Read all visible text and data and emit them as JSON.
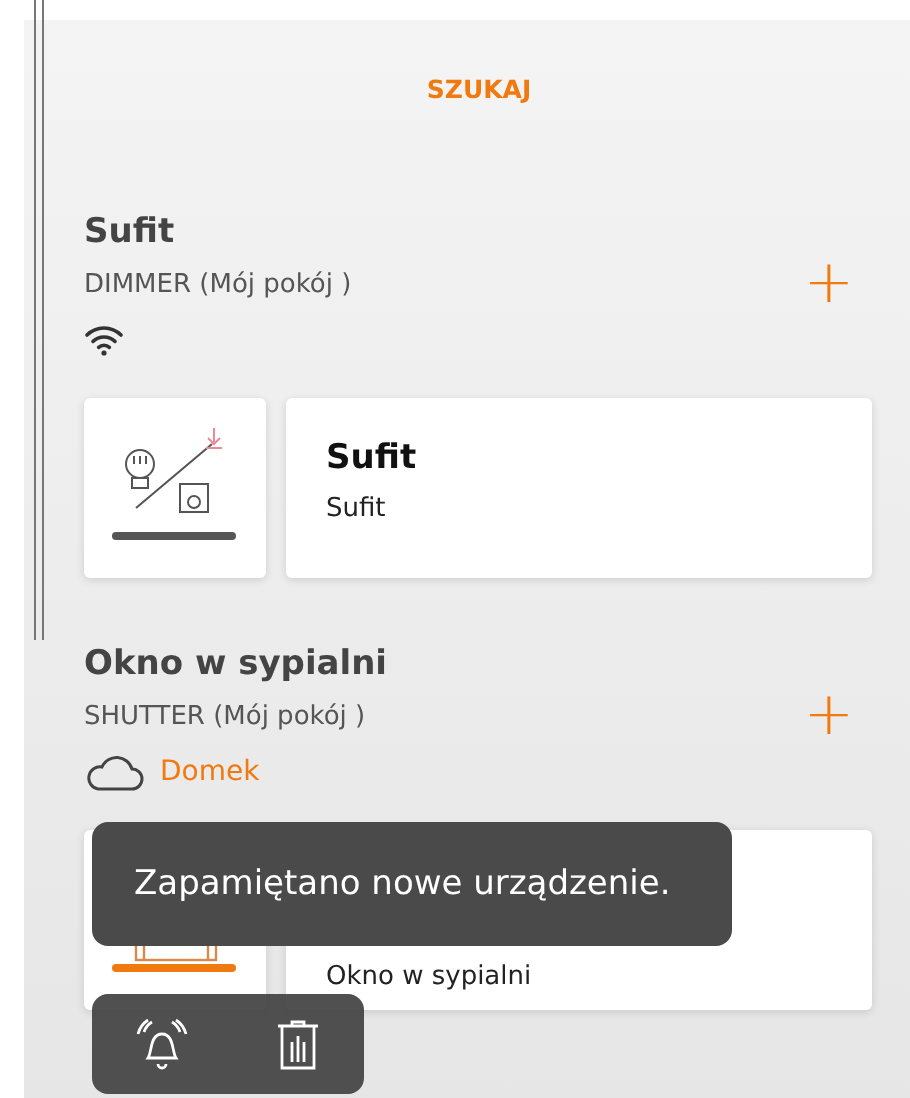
{
  "search_button": "SZUKAJ",
  "devices": [
    {
      "name": "Sufit",
      "type_line": "DIMMER (Mój pokój )",
      "add_button": "+",
      "connection": {
        "kind": "wifi"
      },
      "kind": "dimmer",
      "card_title": "Sufit",
      "card_subtitle": "Sufit"
    },
    {
      "name": "Okno w sypialni",
      "type_line": "SHUTTER (Mój pokój )",
      "add_button": "+",
      "connection": {
        "kind": "cloud",
        "location": "Domek"
      },
      "kind": "shutter",
      "card_subtitle": "Okno w sypialni"
    }
  ],
  "toast": "Zapamiętano nowe urządzenie.",
  "action_bar": [
    {
      "kind": "bell"
    },
    {
      "kind": "trash"
    }
  ]
}
